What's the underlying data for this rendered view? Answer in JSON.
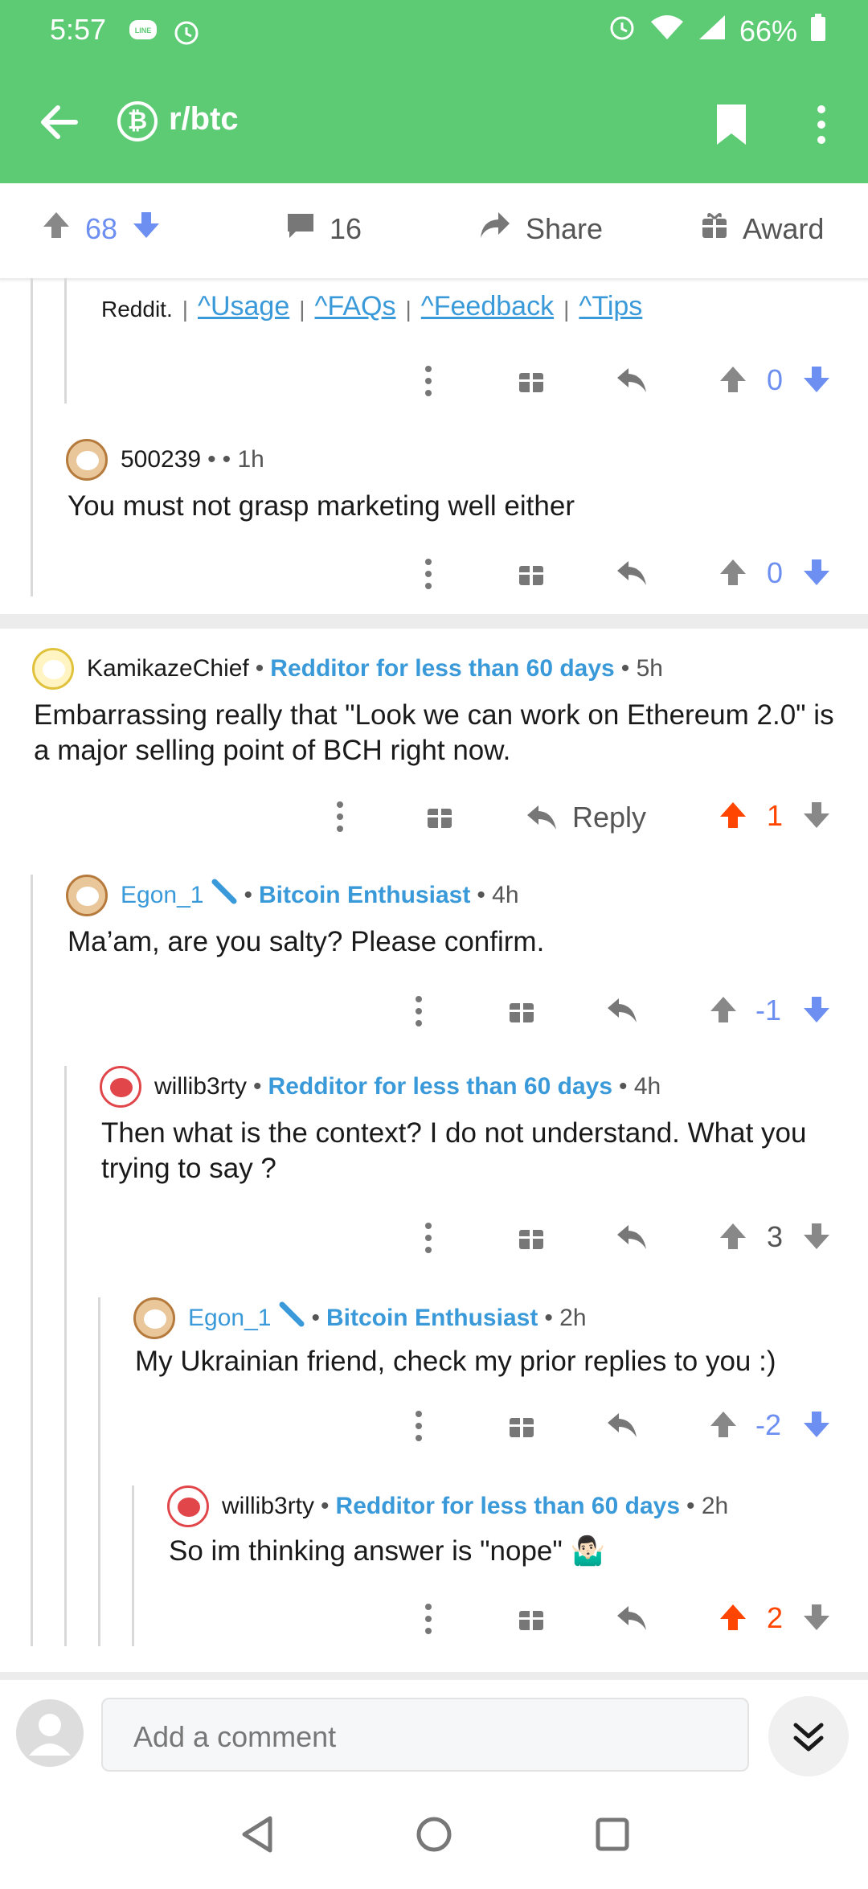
{
  "status": {
    "time": "5:57",
    "battery": "66%"
  },
  "header": {
    "subreddit": "r/btc"
  },
  "post_actions": {
    "upvotes": "68",
    "comments": "16",
    "share": "Share",
    "award": "Award"
  },
  "bot_footer": {
    "prefix": "Reddit.",
    "links": [
      "^Usage",
      "^FAQs",
      "^Feedback",
      "^Tips"
    ],
    "score": "0"
  },
  "comments": [
    {
      "author": "500239",
      "dot": "•",
      "flair": "",
      "time": "• 1h",
      "text": "You must not grasp marketing well either",
      "score": "0"
    },
    {
      "author": "KamikazeChief",
      "dot": "•",
      "flair": "Redditor for less than 60 days",
      "time": "• 5h",
      "text": "Embarrassing really that \"Look we can work on Ethereum 2.0\" is a major selling point of BCH right now.",
      "reply": "Reply",
      "score": "1"
    },
    {
      "author": "Egon_1",
      "dot": "•",
      "flair": "Bitcoin Enthusiast",
      "time": "• 4h",
      "text": "Ma’am, are you salty? Please confirm.",
      "score": "-1"
    },
    {
      "author": "willib3rty",
      "dot": "•",
      "flair": "Redditor for less than 60 days",
      "time": "• 4h",
      "text": "Then what is the context? I do not understand. What you trying to say ?",
      "score": "3"
    },
    {
      "author": "Egon_1",
      "dot": "•",
      "flair": "Bitcoin Enthusiast",
      "time": "• 2h",
      "text": "My Ukrainian friend, check my prior replies to you :)",
      "score": "-2"
    },
    {
      "author": "willib3rty",
      "dot": "•",
      "flair": "Redditor for less than 60 days",
      "time": "• 2h",
      "text": "So im thinking answer is \"nope\" 🤷🏻‍♂️",
      "score": "2"
    }
  ],
  "composer": {
    "placeholder": "Add a comment"
  },
  "colors": {
    "green": "#5DCB74",
    "upvote": "#FF4500",
    "downvote": "#6e8ff2",
    "flair": "#3a9ad9"
  },
  "icons": [
    "back-arrow-icon",
    "bitcoin-icon",
    "bookmark-icon",
    "more-vert-icon",
    "upvote-icon",
    "downvote-icon",
    "comment-icon",
    "share-icon",
    "gift-icon",
    "reply-icon",
    "chevron-down-double-icon"
  ]
}
